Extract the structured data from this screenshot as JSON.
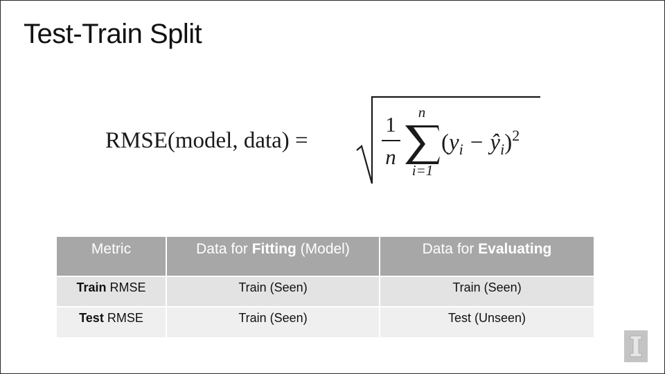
{
  "slide": {
    "title": "Test-Train Split"
  },
  "formula": {
    "lhs": "RMSE(model, data) =",
    "numerator": "1",
    "denominator": "n",
    "sum_upper": "n",
    "sum_lower": "i=1",
    "summand_open": "(",
    "y_i": "y",
    "sub_i": "i",
    "minus": "−",
    "y_hat": "ŷ",
    "close_paren": ")",
    "power": "2"
  },
  "table": {
    "headers": [
      {
        "plain": "Metric",
        "bold": "",
        "suffix": ""
      },
      {
        "plain": "Data for ",
        "bold": "Fitting",
        "suffix": " (Model)"
      },
      {
        "plain": "Data for ",
        "bold": "Evaluating",
        "suffix": ""
      }
    ],
    "rows": [
      {
        "metric_bold": "Train",
        "metric_plain": " RMSE",
        "fitting": "Train (Seen)",
        "evaluating": "Train (Seen)"
      },
      {
        "metric_bold": "Test",
        "metric_plain": " RMSE",
        "fitting": "Train (Seen)",
        "evaluating": "Test (Unseen)"
      }
    ]
  },
  "logo": {
    "icon": "university-block-i-logo",
    "letter": "I"
  }
}
